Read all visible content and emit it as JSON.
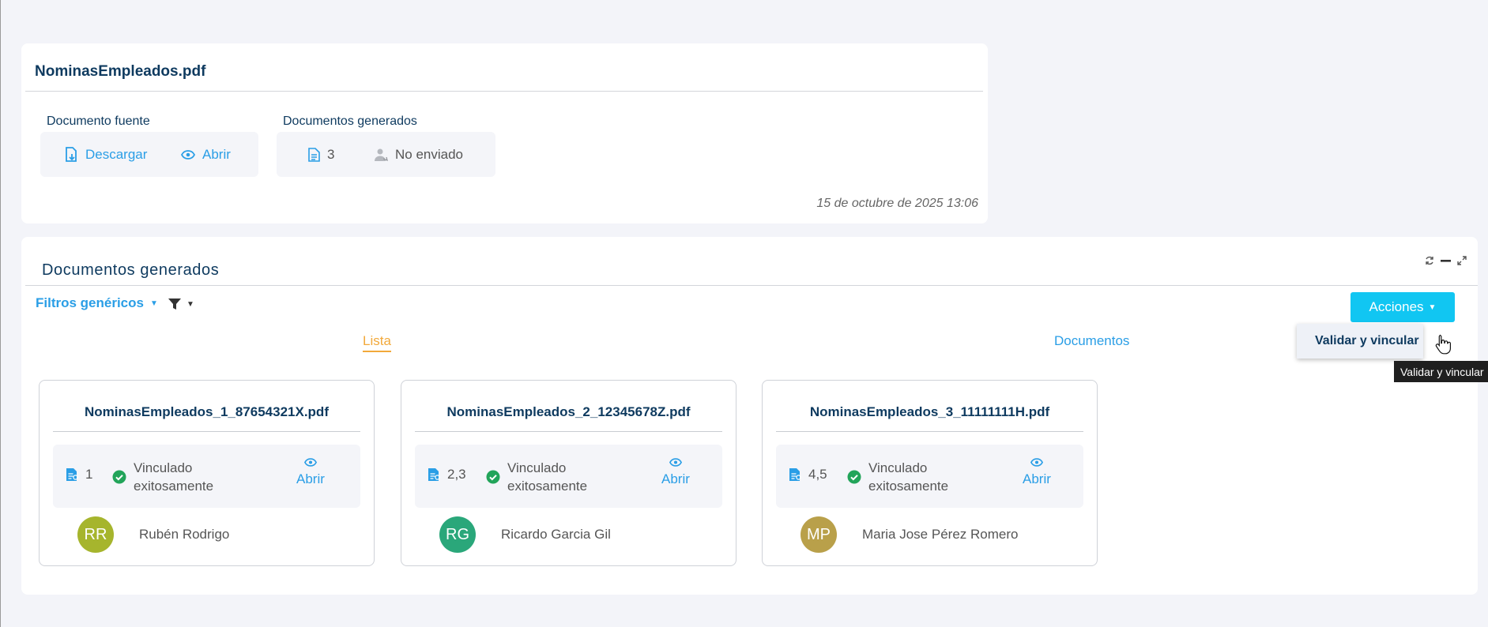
{
  "source_panel": {
    "title": "NominasEmpleados.pdf",
    "source_label": "Documento fuente",
    "download_label": "Descargar",
    "open_label": "Abrir",
    "generated_label": "Documentos generados",
    "generated_count": "3",
    "send_status": "No enviado",
    "timestamp": "15 de octubre de 2025 13:06"
  },
  "generated_panel": {
    "title": "Documentos generados",
    "filters_label": "Filtros genéricos",
    "actions_label": "Acciones",
    "tabs": [
      {
        "label": "Lista",
        "active": true
      },
      {
        "label": "Documentos",
        "active": false
      }
    ],
    "cards": [
      {
        "filename": "NominasEmpleados_1_87654321X.pdf",
        "pages": "1",
        "status_line1": "Vinculado",
        "status_line2": "exitosamente",
        "open_label": "Abrir",
        "initials": "RR",
        "avatar_color": "#a6b52d",
        "person": "Rubén Rodrigo"
      },
      {
        "filename": "NominasEmpleados_2_12345678Z.pdf",
        "pages": "2,3",
        "status_line1": "Vinculado",
        "status_line2": "exitosamente",
        "open_label": "Abrir",
        "initials": "RG",
        "avatar_color": "#2aa77a",
        "person": "Ricardo Garcia Gil"
      },
      {
        "filename": "NominasEmpleados_3_11111111H.pdf",
        "pages": "4,5",
        "status_line1": "Vinculado",
        "status_line2": "exitosamente",
        "open_label": "Abrir",
        "initials": "MP",
        "avatar_color": "#b9a04a",
        "person": "Maria Jose Pérez Romero"
      }
    ]
  },
  "dropdown": {
    "item_label": "Validar y vincular"
  },
  "tooltip": {
    "text": "Validar y vincular"
  },
  "colors": {
    "accent": "#2a9ee6",
    "button": "#11c6f2",
    "title": "#0e3a5f",
    "active_tab": "#f2a93b",
    "success": "#22a45a"
  }
}
